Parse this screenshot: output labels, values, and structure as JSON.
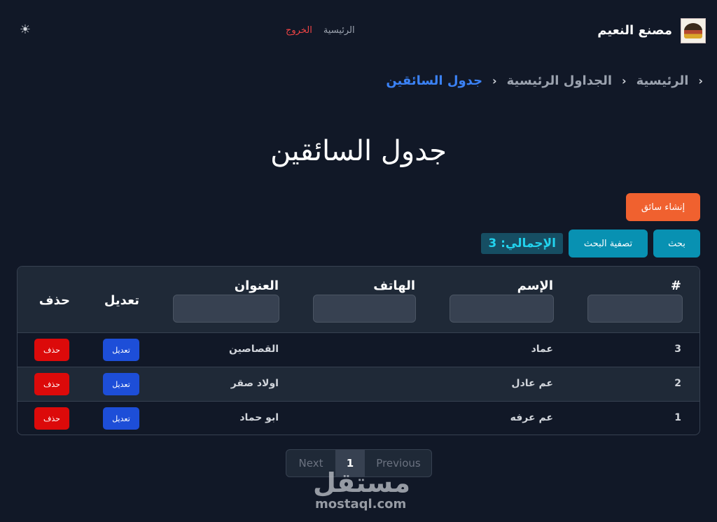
{
  "brand": {
    "name": "مصنع النعيم"
  },
  "nav": {
    "home": "الرئيسية",
    "logout": "الخروج"
  },
  "breadcrumb": {
    "home": "الرئيسية",
    "tables": "الجداول الرئيسية",
    "current": "جدول السائقين"
  },
  "page": {
    "title": "جدول السائقين"
  },
  "actions": {
    "create": "إنشاء سائق",
    "search": "بحث",
    "filter": "تصفية البحث",
    "total": "الإجمالي: 3"
  },
  "table": {
    "headers": {
      "num": "#",
      "name": "الإسم",
      "phone": "الهاتف",
      "address": "العنوان",
      "edit": "تعديل",
      "delete": "حذف"
    },
    "rows": [
      {
        "num": "3",
        "name": "عماد",
        "phone": "",
        "address": "القصاصين",
        "edit": "تعديل",
        "delete": "حذف"
      },
      {
        "num": "2",
        "name": "عم عادل",
        "phone": "",
        "address": "اولاد صقر",
        "edit": "تعديل",
        "delete": "حذف"
      },
      {
        "num": "1",
        "name": "عم عرفه",
        "phone": "",
        "address": "ابو حماد",
        "edit": "تعديل",
        "delete": "حذف"
      }
    ]
  },
  "pagination": {
    "next": "Next",
    "current": "1",
    "previous": "Previous"
  },
  "watermark": {
    "arabic": "مستقل",
    "site": "mostaql.com"
  },
  "colors": {
    "background": "#111827",
    "accent": "#3b82f6",
    "create": "#f0612f",
    "search": "#0891b2",
    "edit": "#1d4ed8",
    "delete": "#dc0a0a"
  },
  "icons": {
    "theme": "sun-icon",
    "breadcrumb_separator": "chevron-left-icon"
  }
}
